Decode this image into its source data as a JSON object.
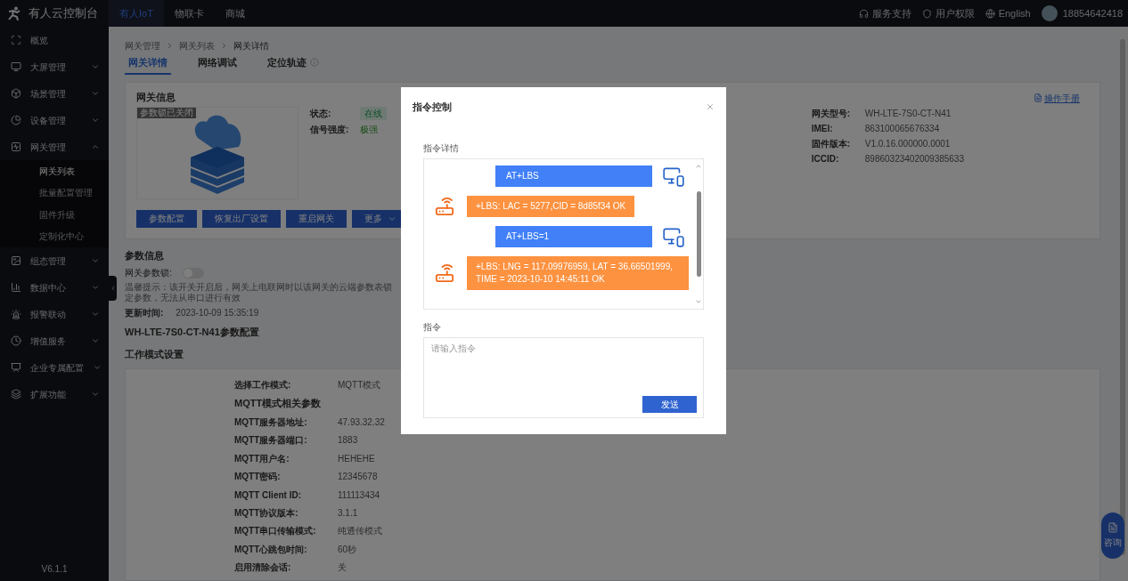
{
  "brand": {
    "title": "有人云控制台"
  },
  "top_nav": [
    {
      "label": "有人IoT",
      "selected": true
    },
    {
      "label": "物联卡",
      "selected": false
    },
    {
      "label": "商城",
      "selected": false
    }
  ],
  "top_right": {
    "support": "服务支持",
    "permission": "用户权限",
    "language": "English",
    "user": "18854642418"
  },
  "sidebar": {
    "items": [
      {
        "label": "概览"
      },
      {
        "label": "大屏管理",
        "expanded": false
      },
      {
        "label": "场景管理",
        "expanded": false
      },
      {
        "label": "设备管理",
        "expanded": false
      },
      {
        "label": "网关管理",
        "expanded": true,
        "children": [
          {
            "label": "网关列表",
            "selected": true
          },
          {
            "label": "批量配置管理",
            "selected": false
          },
          {
            "label": "固件升级",
            "selected": false
          },
          {
            "label": "定制化中心",
            "selected": false
          }
        ]
      },
      {
        "label": "组态管理",
        "expanded": false
      },
      {
        "label": "数据中心",
        "expanded": false
      },
      {
        "label": "报警联动",
        "expanded": false
      },
      {
        "label": "增值服务",
        "expanded": false
      },
      {
        "label": "企业专属配置",
        "expanded": false
      },
      {
        "label": "扩展功能",
        "expanded": false
      }
    ],
    "version": "V6.1.1"
  },
  "breadcrumb": [
    "网关管理",
    "网关列表",
    "网关详情"
  ],
  "tabs": [
    {
      "label": "网关详情",
      "selected": true
    },
    {
      "label": "网络调试",
      "selected": false
    },
    {
      "label": "定位轨迹",
      "selected": false
    }
  ],
  "gateway_info": {
    "title": "网关信息",
    "lock_tag": "参数锁已关闭",
    "status_label": "状态:",
    "status": "在线",
    "signal_label": "信号强度:",
    "signal": "极强",
    "manual_link": "操作手册",
    "buttons": [
      "参数配置",
      "恢复出厂设置",
      "重启网关",
      "更多"
    ],
    "fields": [
      {
        "label": "网关型号:",
        "value": "WH-LTE-7S0-CT-N41"
      },
      {
        "label": "IMEI:",
        "value": "863100065676334"
      },
      {
        "label": "固件版本:",
        "value": "V1.0.16.000000.0001"
      },
      {
        "label": "ICCID:",
        "value": "89860323402009385633"
      }
    ]
  },
  "param_info": {
    "title": "参数信息",
    "lock_label": "网关参数锁:",
    "lock_on": false,
    "hint": "温馨提示：该开关开启后，网关上电联网时以该网关的云端参数表锁定参数，无法从串口进行有效",
    "update_label": "更新时间:",
    "update_time": "2023-10-09 15:35:19"
  },
  "config": {
    "title": "WH-LTE-7S0-CT-N41参数配置",
    "section": "工作模式设置",
    "rows": [
      {
        "kind": "field",
        "label": "选择工作模式:",
        "value": "MQTT模式"
      },
      {
        "kind": "heading",
        "label": "MQTT模式相关参数"
      },
      {
        "kind": "field",
        "label": "MQTT服务器地址:",
        "value": "47.93.32.32"
      },
      {
        "kind": "field",
        "label": "MQTT服务器端口:",
        "value": "1883"
      },
      {
        "kind": "field",
        "label": "MQTT用户名:",
        "value": "HEHEHE"
      },
      {
        "kind": "field",
        "label": "MQTT密码:",
        "value": "12345678"
      },
      {
        "kind": "field",
        "label": "MQTT Client ID:",
        "value": "111113434"
      },
      {
        "kind": "field",
        "label": "MQTT协议版本:",
        "value": "3.1.1"
      },
      {
        "kind": "field",
        "label": "MQTT串口传输模式:",
        "value": "纯透传模式"
      },
      {
        "kind": "field",
        "label": "MQTT心跳包时间:",
        "value": "60秒"
      },
      {
        "kind": "field",
        "label": "启用清除会话:",
        "value": "关"
      }
    ]
  },
  "float_button": "咨询",
  "dialog": {
    "title": "指令控制",
    "log_label": "指令详情",
    "messages": [
      {
        "kind": "sent",
        "text": "AT+LBS"
      },
      {
        "kind": "received",
        "text": "+LBS: LAC = 5277,CID = 8d85f34 OK"
      },
      {
        "kind": "sent",
        "text": "AT+LBS=1"
      },
      {
        "kind": "received",
        "text": "+LBS: LNG = 117.09976959, LAT = 36.66501999, TIME = 2023-10-10 14:45:11 OK"
      }
    ],
    "command_label": "指令",
    "command_placeholder": "请输入指令",
    "send": "发送"
  }
}
